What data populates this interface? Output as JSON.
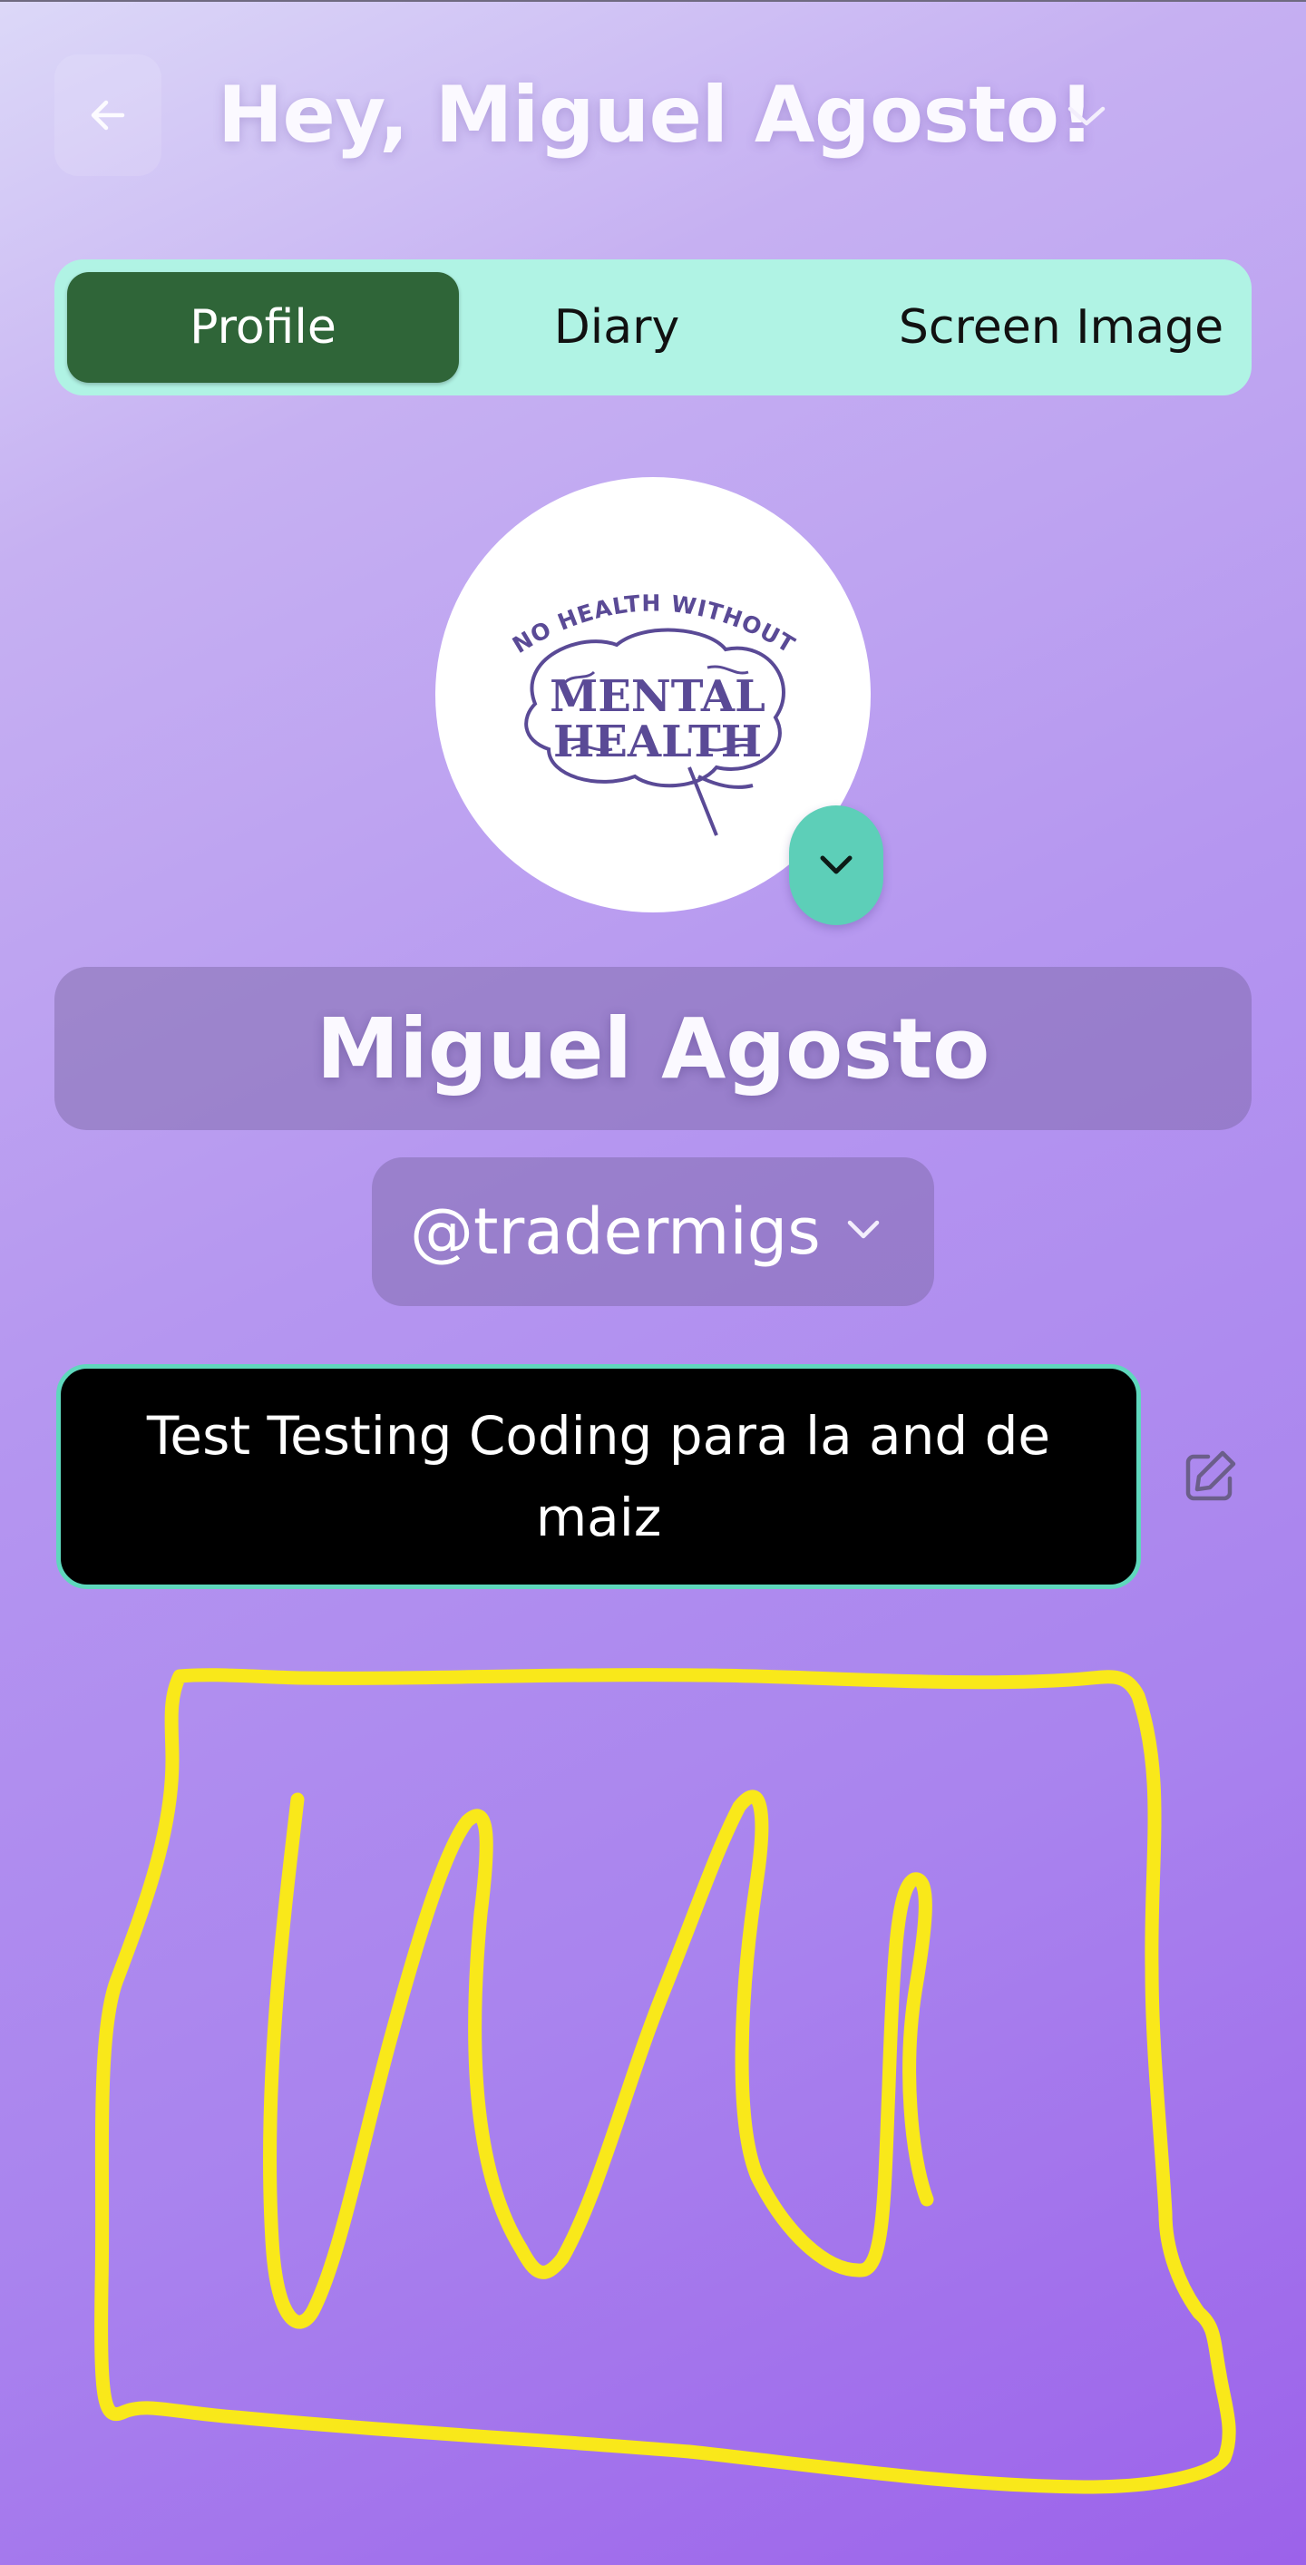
{
  "header": {
    "back_icon": "arrow-left-icon",
    "greeting": "Hey, Miguel Agosto!",
    "menu_icon": "chevron-down-icon"
  },
  "tabs": [
    {
      "label": "Profile",
      "active": true
    },
    {
      "label": "Diary",
      "active": false
    },
    {
      "label": "Screen Image",
      "active": false
    }
  ],
  "profile": {
    "avatar_logo_text": [
      "NO HEALTH WITHOUT",
      "MENTAL",
      "HEALTH"
    ],
    "avatar_toggle_icon": "chevron-down-icon",
    "name": "Miguel Agosto",
    "handle": "@tradermigs",
    "handle_icon": "chevron-down-icon",
    "bio": "Test Testing Coding para la and de maiz",
    "edit_icon": "pencil-square-icon"
  },
  "drawing": {
    "stroke_color": "#f9e81a"
  },
  "colors": {
    "tab_bar": "#b0f3e4",
    "tab_active": "#2f6538",
    "accent_teal": "#5dcfb8",
    "bio_background": "#000000"
  }
}
